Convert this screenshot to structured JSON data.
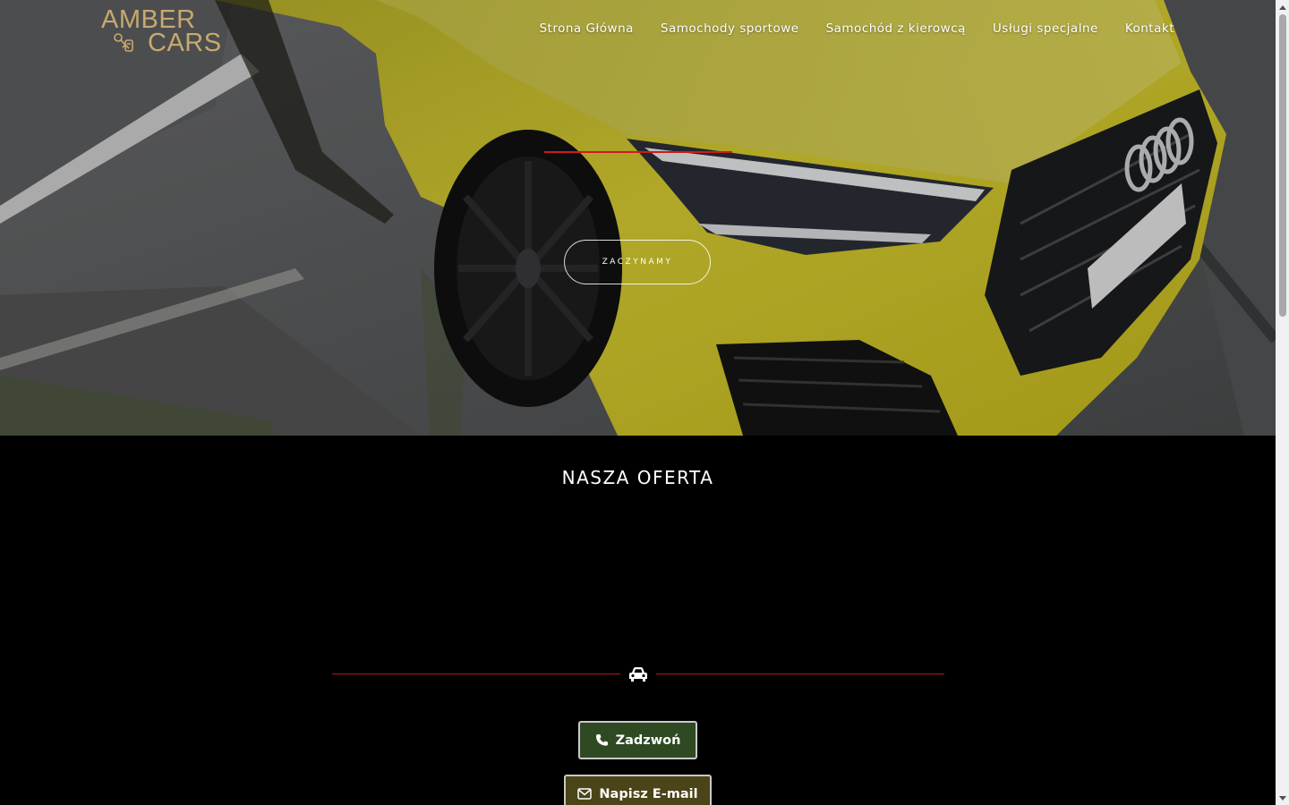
{
  "brand": {
    "line1": "AMBER",
    "line2": "CARS"
  },
  "nav": {
    "items": [
      {
        "label": "Strona Główna"
      },
      {
        "label": "Samochody sportowe"
      },
      {
        "label": "Samochód z kierowcą"
      },
      {
        "label": "Usługi specjalne"
      },
      {
        "label": "Kontakt"
      }
    ]
  },
  "hero": {
    "cta_label": "ZACZYNAMY"
  },
  "offer": {
    "title": "NASZA OFERTA"
  },
  "contact": {
    "call_label": "Zadzwoń",
    "mail_label": "Napisz E-mail"
  },
  "colors": {
    "accent_red": "#d11a1a",
    "logo_gold": "#c8a96e",
    "call_button_bg": "#2f4a22",
    "mail_button_bg": "#4a4418",
    "car_yellow": "#d9cc2a"
  },
  "icons": {
    "divider": "car-icon",
    "call": "phone-icon",
    "mail": "envelope-icon",
    "logo": "car-keys-icon"
  }
}
